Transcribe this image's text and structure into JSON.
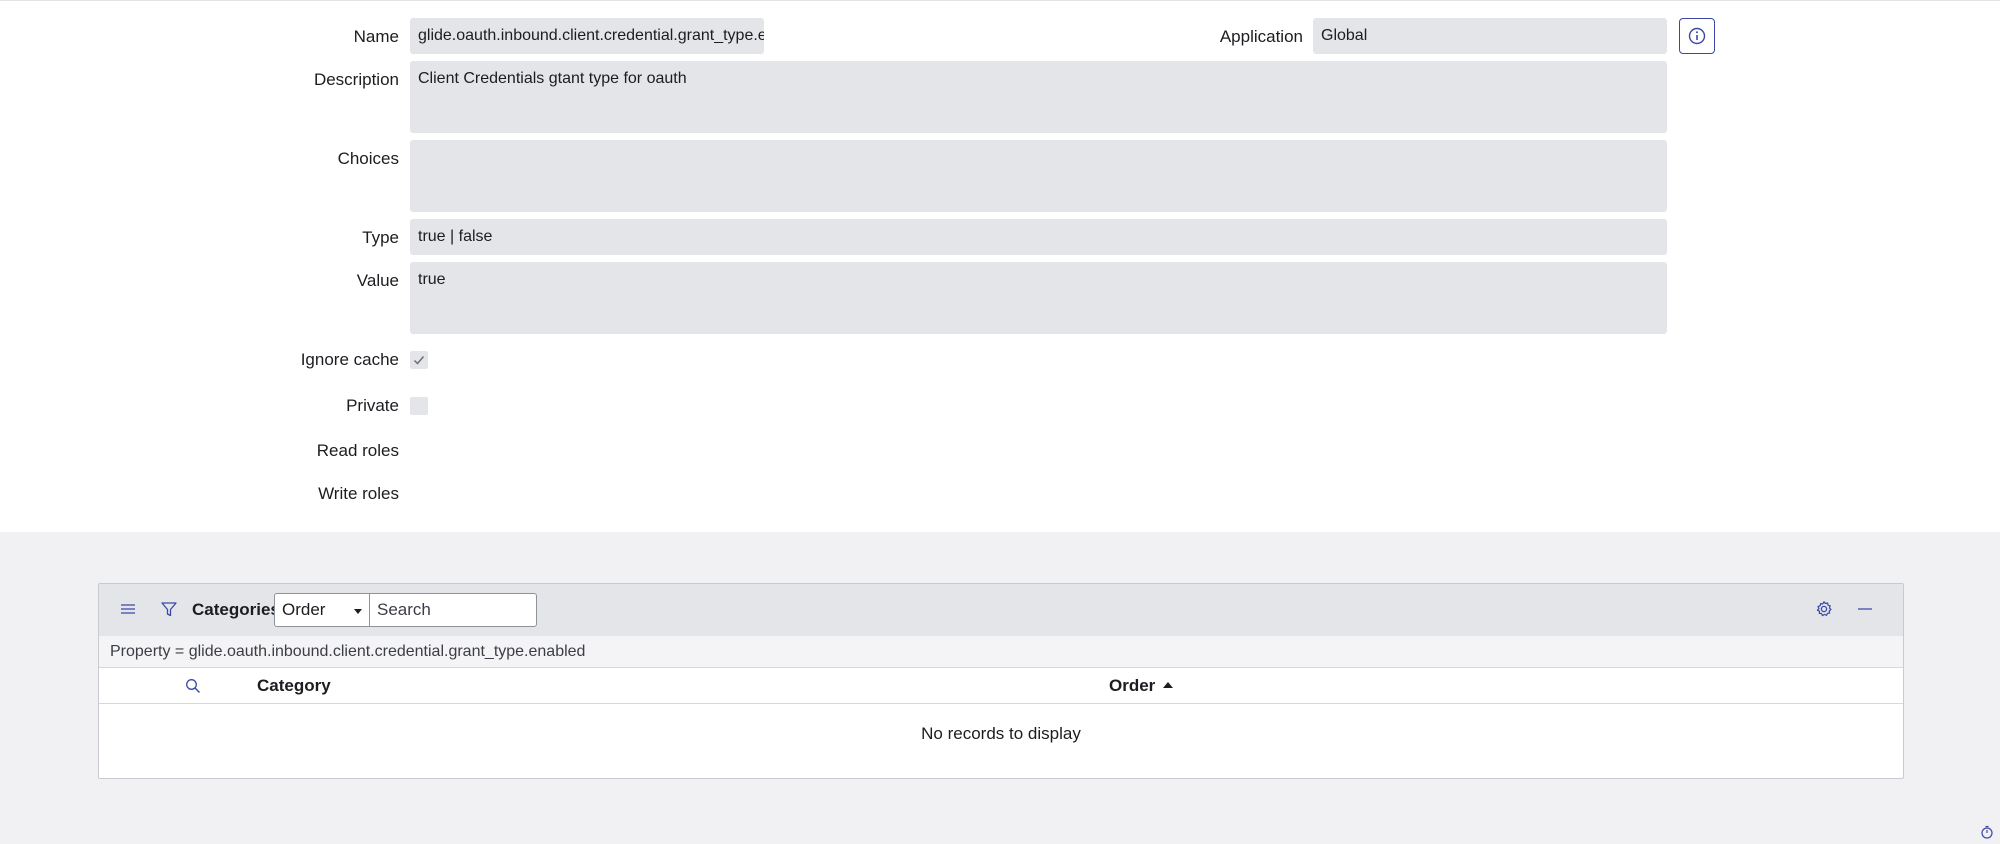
{
  "form": {
    "name_label": "Name",
    "name_value": "glide.oauth.inbound.client.credential.grant_type.enabled",
    "application_label": "Application",
    "application_value": "Global",
    "description_label": "Description",
    "description_value": "Client Credentials gtant type for oauth",
    "choices_label": "Choices",
    "choices_value": "",
    "type_label": "Type",
    "type_value": "true | false",
    "value_label": "Value",
    "value_value": "true",
    "ignore_cache_label": "Ignore cache",
    "ignore_cache_checked": true,
    "private_label": "Private",
    "private_checked": false,
    "read_roles_label": "Read roles",
    "write_roles_label": "Write roles"
  },
  "related_list": {
    "title": "Categories",
    "select_value": "Order",
    "search_placeholder": "Search",
    "breadcrumb": "Property = glide.oauth.inbound.client.credential.grant_type.enabled",
    "columns": [
      "Category",
      "Order"
    ],
    "sort_column": "Order",
    "sort_direction": "ascending",
    "empty_message": "No records to display"
  },
  "icons": [
    "info-icon",
    "menu-icon",
    "filter-icon",
    "search-icon",
    "gear-icon",
    "minimize-icon",
    "stopwatch-icon",
    "checkmark-icon"
  ],
  "colors": {
    "accent": "#3c48a8",
    "field_bg": "#e4e5e9",
    "page_bg": "#f1f1f3"
  }
}
